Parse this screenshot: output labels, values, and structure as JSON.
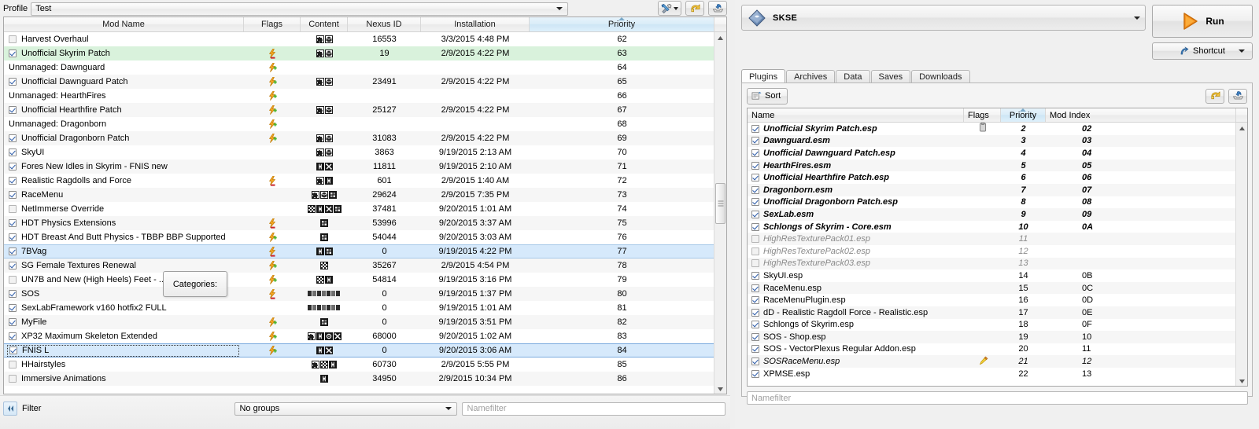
{
  "profile": {
    "label": "Profile",
    "value": "Test"
  },
  "toolbar_top": {
    "tools_icon": "tools-dropdown-icon",
    "undo_icon": "undo-icon",
    "export_icon": "export-icon"
  },
  "mod_table": {
    "columns": [
      "Mod Name",
      "Flags",
      "Content",
      "Nexus ID",
      "Installation",
      "Priority"
    ],
    "sorted_column": "Priority",
    "rows": [
      {
        "checked": false,
        "managed": true,
        "name": "Harvest Overhaul",
        "flags": [],
        "content": [
          "puzzle",
          "box"
        ],
        "nexus": "16553",
        "install": "3/3/2015 4:48 PM",
        "priority": "62",
        "style": ""
      },
      {
        "checked": true,
        "managed": true,
        "name": "Unofficial Skyrim Patch",
        "flags": [
          "bolt-red"
        ],
        "content": [
          "puzzle",
          "box"
        ],
        "nexus": "19",
        "install": "2/9/2015 4:22 PM",
        "priority": "63",
        "style": "green"
      },
      {
        "checked": null,
        "managed": false,
        "name": "Unmanaged: Dawnguard",
        "flags": [
          "bolt-green"
        ],
        "content": [],
        "nexus": "",
        "install": "",
        "priority": "64",
        "style": ""
      },
      {
        "checked": true,
        "managed": true,
        "name": "Unofficial Dawnguard Patch",
        "flags": [
          "bolt-green"
        ],
        "content": [
          "puzzle",
          "box"
        ],
        "nexus": "23491",
        "install": "2/9/2015 4:22 PM",
        "priority": "65",
        "style": "alt"
      },
      {
        "checked": null,
        "managed": false,
        "name": "Unmanaged: HearthFires",
        "flags": [
          "bolt-green"
        ],
        "content": [],
        "nexus": "",
        "install": "",
        "priority": "66",
        "style": ""
      },
      {
        "checked": true,
        "managed": true,
        "name": "Unofficial Hearthfire Patch",
        "flags": [
          "bolt-green"
        ],
        "content": [
          "puzzle",
          "box"
        ],
        "nexus": "25127",
        "install": "2/9/2015 4:22 PM",
        "priority": "67",
        "style": "alt"
      },
      {
        "checked": null,
        "managed": false,
        "name": "Unmanaged: Dragonborn",
        "flags": [
          "bolt-green"
        ],
        "content": [],
        "nexus": "",
        "install": "",
        "priority": "68",
        "style": ""
      },
      {
        "checked": true,
        "managed": true,
        "name": "Unofficial Dragonborn Patch",
        "flags": [
          "bolt-green"
        ],
        "content": [
          "puzzle",
          "box"
        ],
        "nexus": "31083",
        "install": "2/9/2015 4:22 PM",
        "priority": "69",
        "style": "alt"
      },
      {
        "checked": true,
        "managed": true,
        "name": "SkyUI",
        "flags": [],
        "content": [
          "puzzle",
          "box"
        ],
        "nexus": "3863",
        "install": "9/19/2015 2:13 AM",
        "priority": "70",
        "style": ""
      },
      {
        "checked": true,
        "managed": true,
        "name": "Fores New Idles in Skyrim - FNIS new",
        "flags": [],
        "content": [
          "skel",
          "bone"
        ],
        "nexus": "11811",
        "install": "9/19/2015 2:10 AM",
        "priority": "71",
        "style": "alt"
      },
      {
        "checked": true,
        "managed": true,
        "name": "Realistic Ragdolls and Force",
        "flags": [
          "bolt-red"
        ],
        "content": [
          "puzzle",
          "skel"
        ],
        "nexus": "601",
        "install": "2/9/2015 1:40 AM",
        "priority": "72",
        "style": ""
      },
      {
        "checked": true,
        "managed": true,
        "name": "RaceMenu",
        "flags": [],
        "content": [
          "puzzle",
          "box",
          "dark"
        ],
        "nexus": "29624",
        "install": "2/9/2015 7:35 PM",
        "priority": "73",
        "style": "alt"
      },
      {
        "checked": false,
        "managed": true,
        "name": "NetImmerse Override",
        "flags": [],
        "content": [
          "chk",
          "skel",
          "bone",
          "dark"
        ],
        "nexus": "37481",
        "install": "9/20/2015 1:01 AM",
        "priority": "74",
        "style": ""
      },
      {
        "checked": true,
        "managed": true,
        "name": "HDT Physics Extensions",
        "flags": [
          "bolt-red"
        ],
        "content": [
          "dark"
        ],
        "nexus": "53996",
        "install": "9/20/2015 3:37 AM",
        "priority": "75",
        "style": "alt"
      },
      {
        "checked": true,
        "managed": true,
        "name": "HDT Breast And Butt Physics - TBBP BBP Supported",
        "flags": [
          "bolt-green"
        ],
        "content": [
          "dark"
        ],
        "nexus": "54044",
        "install": "9/20/2015 3:03 AM",
        "priority": "76",
        "style": ""
      },
      {
        "checked": true,
        "managed": true,
        "name": "7BVag",
        "flags": [
          "bolt-red"
        ],
        "content": [
          "skel",
          "dark"
        ],
        "nexus": "0",
        "install": "9/19/2015 4:22 PM",
        "priority": "77",
        "style": "sel"
      },
      {
        "checked": true,
        "managed": true,
        "name": "SG Female Textures Renewal",
        "flags": [
          "bolt-green"
        ],
        "content": [
          "chk"
        ],
        "nexus": "35267",
        "install": "2/9/2015 4:54 PM",
        "priority": "78",
        "style": "alt"
      },
      {
        "checked": false,
        "managed": true,
        "name": "UN7B and New (High Heels) Feet - ...Repl...",
        "flags": [
          "bolt-green"
        ],
        "content": [
          "chk",
          "skel"
        ],
        "nexus": "54814",
        "install": "9/19/2015 3:16 PM",
        "priority": "79",
        "style": ""
      },
      {
        "checked": true,
        "managed": true,
        "name": "SOS",
        "flags": [
          "bolt-red"
        ],
        "content": [
          "tiny"
        ],
        "nexus": "0",
        "install": "9/19/2015 1:37 PM",
        "priority": "80",
        "style": "alt"
      },
      {
        "checked": true,
        "managed": true,
        "name": "SexLabFramework v160 hotfix2 FULL",
        "flags": [],
        "content": [
          "tiny"
        ],
        "nexus": "0",
        "install": "9/19/2015 1:01 AM",
        "priority": "81",
        "style": ""
      },
      {
        "checked": true,
        "managed": true,
        "name": "MyFile",
        "flags": [
          "bolt-green"
        ],
        "content": [
          "dark"
        ],
        "nexus": "0",
        "install": "9/19/2015 3:51 PM",
        "priority": "82",
        "style": "alt"
      },
      {
        "checked": true,
        "managed": true,
        "name": "XP32 Maximum Skeleton Extended",
        "flags": [
          "bolt-green"
        ],
        "content": [
          "puzzle",
          "skel",
          "gear",
          "bone"
        ],
        "nexus": "68000",
        "install": "9/20/2015 1:02 AM",
        "priority": "83",
        "style": ""
      },
      {
        "checked": true,
        "managed": true,
        "name": "FNIS L",
        "flags": [
          "bolt-green"
        ],
        "content": [
          "skel",
          "bone"
        ],
        "nexus": "0",
        "install": "9/20/2015 3:06 AM",
        "priority": "84",
        "style": "sel2",
        "editing": true
      },
      {
        "checked": false,
        "managed": true,
        "name": "HHairstyles",
        "flags": [],
        "content": [
          "puzzle",
          "chk",
          "skel"
        ],
        "nexus": "60730",
        "install": "2/9/2015 5:55 PM",
        "priority": "85",
        "style": ""
      },
      {
        "checked": false,
        "managed": true,
        "name": "Immersive Animations",
        "flags": [],
        "content": [
          "skel"
        ],
        "nexus": "34950",
        "install": "2/9/2015 10:34 PM",
        "priority": "86",
        "style": "alt"
      }
    ]
  },
  "tooltip": {
    "text": "Categories:"
  },
  "filter_bar": {
    "collapse_icon": "collapse-left-icon",
    "label": "Filter",
    "group_value": "No groups",
    "namefilter_placeholder": "Namefilter"
  },
  "executable": {
    "name": "SKSE",
    "icon": "skse-diamond-icon",
    "run_label": "Run",
    "run_icon": "play-icon",
    "shortcut_label": "Shortcut",
    "shortcut_icon": "shortcut-arrow-icon"
  },
  "tabs": [
    {
      "label": "Plugins",
      "active": true
    },
    {
      "label": "Archives",
      "active": false
    },
    {
      "label": "Data",
      "active": false
    },
    {
      "label": "Saves",
      "active": false
    },
    {
      "label": "Downloads",
      "active": false
    }
  ],
  "plugin_panel": {
    "sort_label": "Sort",
    "sort_icon": "sort-icon",
    "restore_icon": "undo-icon",
    "save_icon": "export-icon",
    "columns": [
      "Name",
      "Flags",
      "Priority",
      "Mod Index"
    ],
    "sorted_column": "Priority",
    "namefilter_placeholder": "Namefilter",
    "rows": [
      {
        "checked": true,
        "name": "Unofficial Skyrim Patch.esp",
        "flags": [
          "note"
        ],
        "priority": "2",
        "index": "02",
        "style": "master"
      },
      {
        "checked": true,
        "name": "Dawnguard.esm",
        "flags": [],
        "priority": "3",
        "index": "03",
        "style": "master alt"
      },
      {
        "checked": true,
        "name": "Unofficial Dawnguard Patch.esp",
        "flags": [],
        "priority": "4",
        "index": "04",
        "style": "master"
      },
      {
        "checked": true,
        "name": "HearthFires.esm",
        "flags": [],
        "priority": "5",
        "index": "05",
        "style": "master alt"
      },
      {
        "checked": true,
        "name": "Unofficial Hearthfire Patch.esp",
        "flags": [],
        "priority": "6",
        "index": "06",
        "style": "master"
      },
      {
        "checked": true,
        "name": "Dragonborn.esm",
        "flags": [],
        "priority": "7",
        "index": "07",
        "style": "master alt"
      },
      {
        "checked": true,
        "name": "Unofficial Dragonborn Patch.esp",
        "flags": [],
        "priority": "8",
        "index": "08",
        "style": "master"
      },
      {
        "checked": true,
        "name": "SexLab.esm",
        "flags": [],
        "priority": "9",
        "index": "09",
        "style": "master alt"
      },
      {
        "checked": true,
        "name": "Schlongs of Skyrim - Core.esm",
        "flags": [],
        "priority": "10",
        "index": "0A",
        "style": "master"
      },
      {
        "checked": false,
        "name": "HighResTexturePack01.esp",
        "flags": [],
        "priority": "11",
        "index": "",
        "style": "disabled alt"
      },
      {
        "checked": false,
        "name": "HighResTexturePack02.esp",
        "flags": [],
        "priority": "12",
        "index": "",
        "style": "disabled"
      },
      {
        "checked": false,
        "name": "HighResTexturePack03.esp",
        "flags": [],
        "priority": "13",
        "index": "",
        "style": "disabled alt"
      },
      {
        "checked": true,
        "name": "SkyUI.esp",
        "flags": [],
        "priority": "14",
        "index": "0B",
        "style": ""
      },
      {
        "checked": true,
        "name": "RaceMenu.esp",
        "flags": [],
        "priority": "15",
        "index": "0C",
        "style": "alt"
      },
      {
        "checked": true,
        "name": "RaceMenuPlugin.esp",
        "flags": [],
        "priority": "16",
        "index": "0D",
        "style": ""
      },
      {
        "checked": true,
        "name": "dD - Realistic Ragdoll Force - Realistic.esp",
        "flags": [],
        "priority": "17",
        "index": "0E",
        "style": "alt"
      },
      {
        "checked": true,
        "name": "Schlongs of Skyrim.esp",
        "flags": [],
        "priority": "18",
        "index": "0F",
        "style": ""
      },
      {
        "checked": true,
        "name": "SOS - Shop.esp",
        "flags": [],
        "priority": "19",
        "index": "10",
        "style": "alt"
      },
      {
        "checked": true,
        "name": "SOS - VectorPlexus Regular Addon.esp",
        "flags": [],
        "priority": "20",
        "index": "11",
        "style": ""
      },
      {
        "checked": true,
        "name": "SOSRaceMenu.esp",
        "flags": [
          "bell"
        ],
        "priority": "21",
        "index": "12",
        "style": "italic alt"
      },
      {
        "checked": true,
        "name": "XPMSE.esp",
        "flags": [],
        "priority": "22",
        "index": "13",
        "style": ""
      }
    ]
  },
  "colors": {
    "row_green": "#d9f2dc",
    "row_selected": "#d6e9fb",
    "sorted_header": "#d9ecf8",
    "run_orange": "#f08a1e"
  }
}
